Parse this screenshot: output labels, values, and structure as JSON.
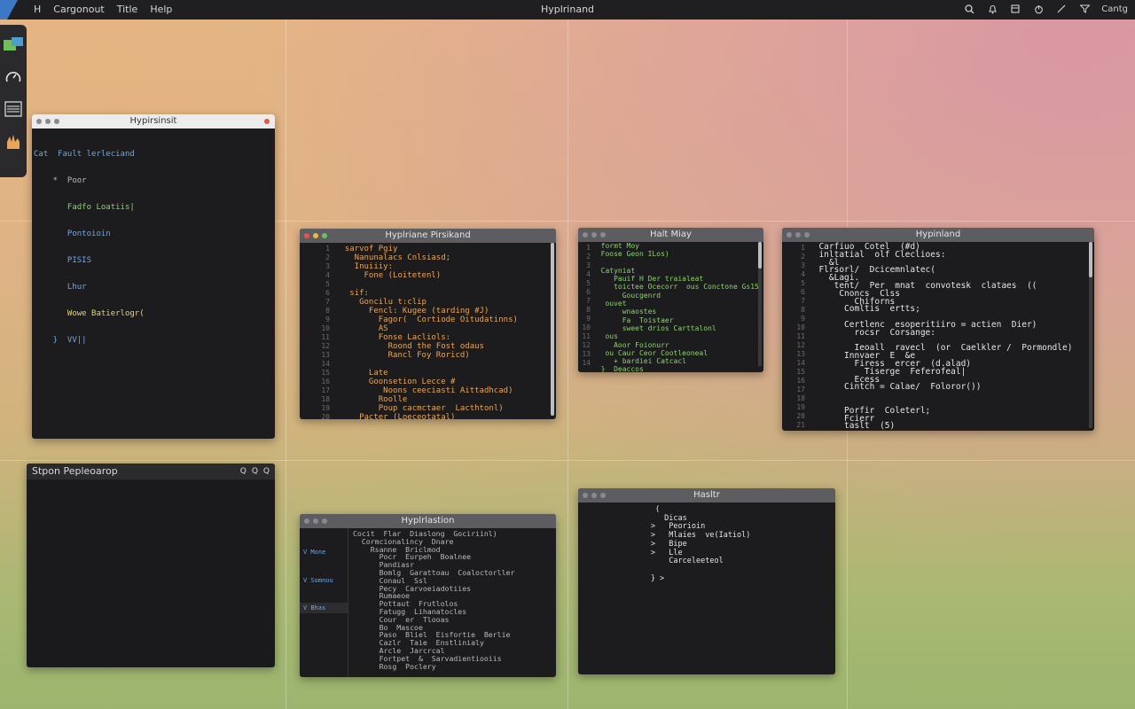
{
  "topbar": {
    "app_icon": "H",
    "menu": [
      "Cargonout",
      "Title",
      "Help"
    ],
    "title": "Hyplrinand",
    "clock": "Cantg",
    "icons": [
      "search-icon",
      "bell-icon",
      "window-icon",
      "power-icon",
      "edit-icon",
      "filter-icon"
    ]
  },
  "colors": {
    "accent": "#6fbf5a",
    "close": "#e5534b",
    "window_bg": "#1c1c1e"
  },
  "win1": {
    "title": "Hypirsinsit",
    "lines": [
      "Cat  Fault lerleciand",
      "    *  Poor",
      "       Fadfo Loatiis|",
      "       Pontoioin",
      "       PISIS",
      "       Lhur",
      "       Wowe Batierlogr(",
      "    }  VV||"
    ]
  },
  "win2": {
    "title": "Hyplriane Pirsikand",
    "gutter": [
      "1",
      "2",
      "3",
      "4",
      "5",
      "6",
      "7",
      "8",
      "9",
      "10",
      "11",
      "12",
      "13",
      "14",
      "15",
      "16",
      "17",
      "18",
      "19",
      "20",
      "21",
      "22"
    ],
    "lines": [
      "  sarvof Pgiy",
      "    Nanunalacs Cnlsiasd;",
      "    Inuiiiy:",
      "      Fone (Loitetenl)",
      "",
      "   sif:",
      "     Goncilu t:clip",
      "       Fencl: Kugee (tarding #J)",
      "         Fagor(  Cortiode Oitudatinns)",
      "         AS",
      "         Fonse Lacliols:",
      "           Roond the Fost odaus",
      "           Rancl Foy Roricd)",
      "",
      "       Late",
      "       Goonsetion Lecce #",
      "          Noons ceeciasti Aittadhcad)",
      "         Roolle",
      "         Poup cacmctaer  Lacthtonl)",
      "     Pacter (Loeceotatal)",
      "",
      "       Frelne (oat)>",
      "    }"
    ]
  },
  "win3": {
    "title": "Halt Miay",
    "gutter": [
      "1",
      "2",
      "3",
      "4",
      "5",
      "6",
      "7",
      "8",
      "9",
      "10",
      "11",
      "12",
      "13",
      "14"
    ],
    "lines": [
      "  formt Moy",
      "  Foose Geon ILos)",
      "",
      "  Catyniat",
      "     Pauif H Der traialeat",
      "     toictee Ocecorr  ous Conctone Gs15",
      "       Goucgenrd",
      "   ouvet",
      "       wnaostes",
      "       Fa  Toistaer",
      "       sweet drios Carttalonl",
      "   ous",
      "     Aoor Foionurr",
      "   ou Caur Ceor Cootleoneal",
      "     + bardiei Catcacl",
      "  }  Deaccos"
    ]
  },
  "win4": {
    "title": "Hypinland",
    "gutter": [
      "1",
      "2",
      "3",
      "4",
      "5",
      "6",
      "7",
      "8",
      "9",
      "10",
      "11",
      "12",
      "13",
      "14",
      "15",
      "16",
      "17",
      "18",
      "19",
      "20",
      "21",
      "22"
    ],
    "lines": [
      "  Carfiuo  Cotel  (#d)",
      "  inltatial  olf Cleclioes:",
      "    &l",
      "  Flrsorl/  Dcicemnlatec(",
      "    &Lagi.",
      "     tent/  Per  mnat  convotesk  clataes  ((",
      "      Cnoncs  Clss",
      "         Chiforns",
      "       Comltis  ertts;",
      "",
      "       Certlenc  esoperitiiro = actien  Dier)",
      "         rocsr  Corsange:",
      "",
      "         Ieoall  ravecl  (or  Caelkler /  Pormondle)",
      "       Innvaer  E  &e",
      "         Firess  ercer  (d.alad)",
      "           Tiserge  Feferofeal|",
      "         Ecess",
      "       Cintch = Calae/  Foloror())",
      "",
      "",
      "       Porfir  Coleterl;",
      "       Fcierr",
      "       taslt  (5)"
    ]
  },
  "win5": {
    "title": "Stpon Pepleoarop",
    "controls": [
      "Q",
      "Q",
      "Q"
    ]
  },
  "win6": {
    "title": "Hyplrlastion",
    "sidebar": [
      "V Mone",
      "V Somnou",
      "V Bhas"
    ],
    "lines": [
      "Cocit  Flar  Diaslong  Gociriinl)",
      "  Cormcionalincy  Dnare",
      "    Rsanne  Briclmod",
      "      Pocr  Eurpeh  Boalnee",
      "      Pandiasr",
      "      Bomlg  Garattoau  Coaloctorller",
      "      Conaul  Ssl",
      "      Pecy  Carvoeiadotiies",
      "      Rumaeoe",
      "      Pottaut  Frutlolos",
      "      Fatugg  Lihanatocles",
      "      Cour  er  Tlooas",
      "      Bo  Mascoe",
      "      Paso  Bliel  Eisfortie  Berlie",
      "      Cazlr  Taie  Enstlinialy",
      "      Arcle  Jarcrcal",
      "      Fortpet  &  Sarvadientiooiis",
      "      Rosg  Poclery"
    ]
  },
  "win7": {
    "title": "Hasltr",
    "lines": [
      "        (",
      "          Dicas",
      "       >   Peorioin",
      "       >   Mlaies  ve(Iatiol)",
      "       >   Bipe",
      "       >   Lle",
      "           Carceleeteol",
      "",
      "       } >"
    ]
  }
}
